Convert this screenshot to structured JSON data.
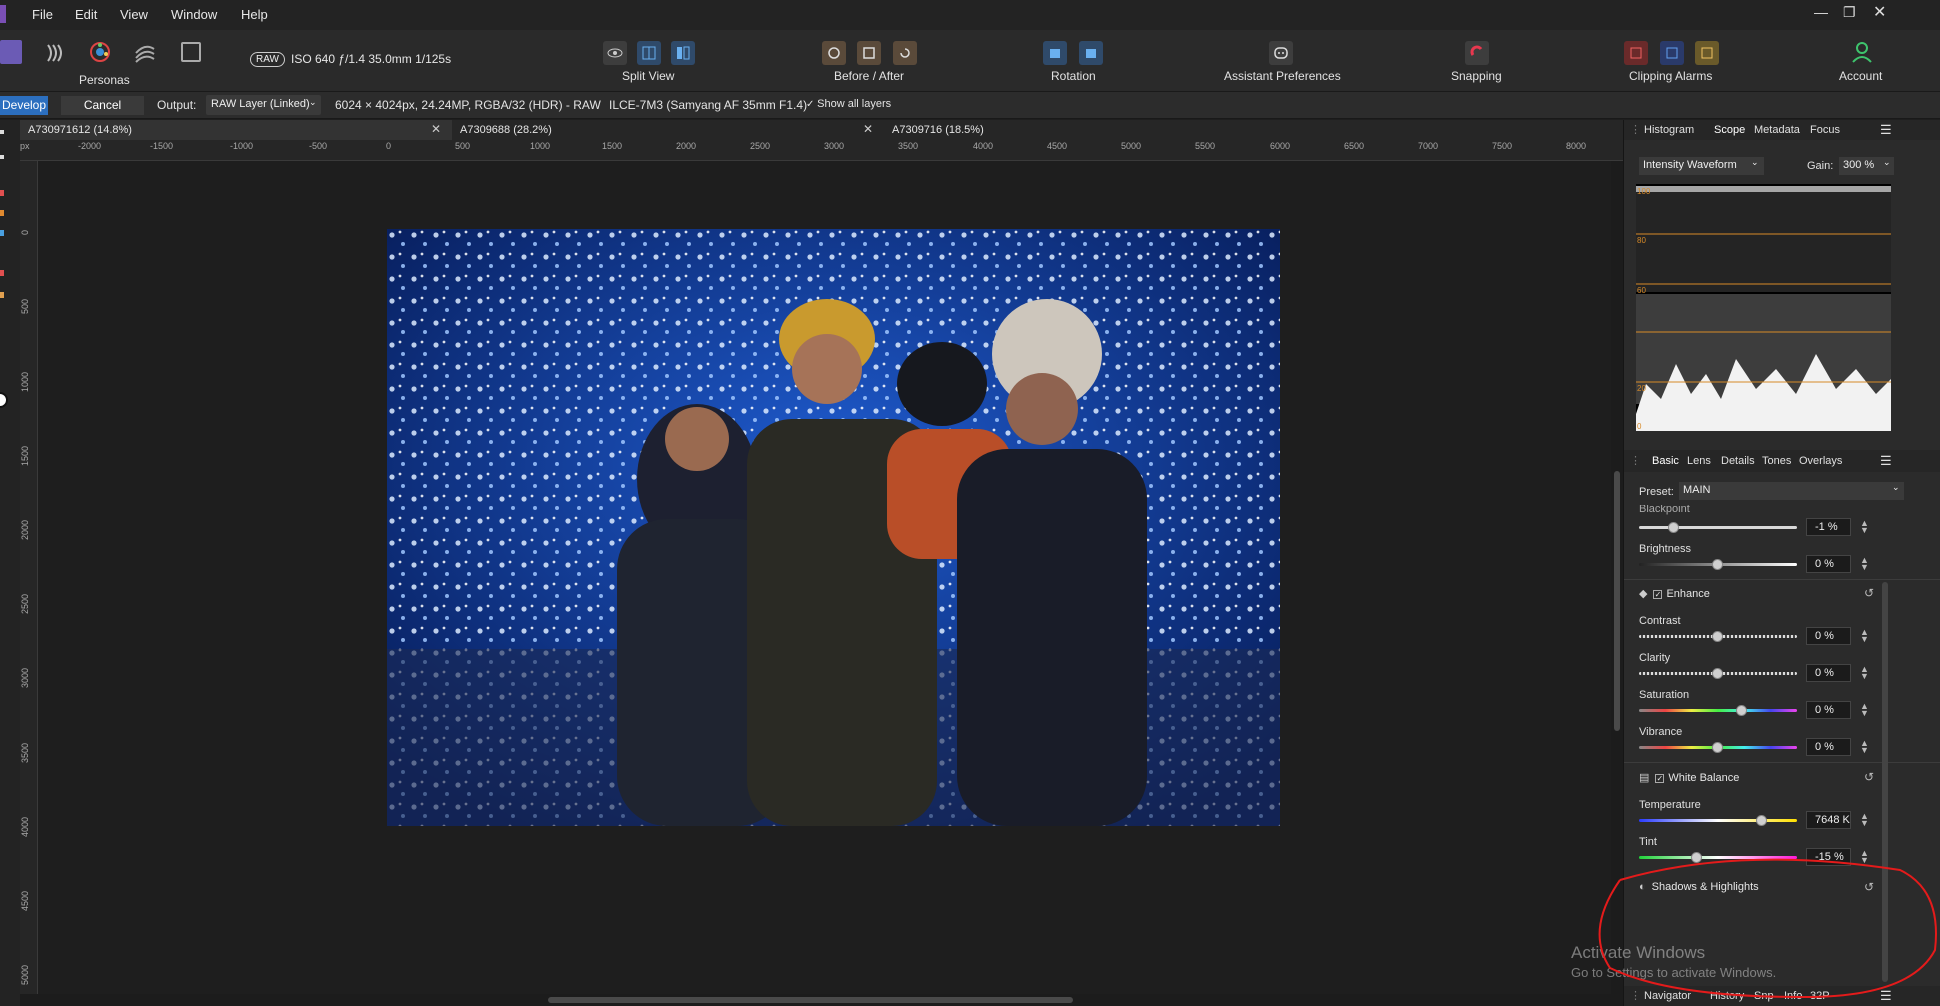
{
  "menu": [
    "File",
    "Edit",
    "View",
    "Window",
    "Help"
  ],
  "toolbar": {
    "personas_label": "Personas",
    "raw_badge": "RAW",
    "exif": "ISO 640 ƒ/1.4 35.0mm 1/125s",
    "split_view": "Split View",
    "before_after": "Before / After",
    "rotation": "Rotation",
    "assistant": "Assistant Preferences",
    "snapping": "Snapping",
    "clipping": "Clipping Alarms",
    "account": "Account"
  },
  "context": {
    "develop": "Develop",
    "cancel": "Cancel",
    "output_label": "Output:",
    "output_value": "RAW Layer (Linked)",
    "image_info": "6024 × 4024px, 24.24MP, RGBA/32 (HDR) - RAW",
    "camera": "ILCE-7M3 (Samyang AF 35mm F1.4)",
    "show_layers": "Show all layers"
  },
  "tabs": [
    "A730971612 (14.8%)",
    "A7309688 (28.2%)",
    "A7309716 (18.5%)"
  ],
  "ruler": {
    "unit": "px",
    "h": [
      "-2000",
      "-1500",
      "-1000",
      "-500",
      "0",
      "500",
      "1000",
      "1500",
      "2000",
      "2500",
      "3000",
      "3500",
      "4000",
      "4500",
      "5000",
      "5500",
      "6000",
      "6500",
      "7000",
      "7500",
      "8000"
    ],
    "v": [
      "0",
      "500",
      "1000",
      "1500",
      "2000",
      "2500",
      "3000",
      "3500",
      "4000",
      "4500",
      "5000"
    ]
  },
  "scope_panel": {
    "tabs": [
      "Histogram",
      "Scope",
      "Metadata",
      "Focus"
    ],
    "mode": "Intensity Waveform",
    "gain_label": "Gain:",
    "gain_value": "300 %",
    "levels": [
      "100",
      "80",
      "60",
      "20",
      "0"
    ]
  },
  "basic_panel": {
    "tabs": [
      "Basic",
      "Lens",
      "Details",
      "Tones",
      "Overlays"
    ],
    "preset_label": "Preset:",
    "preset_value": "MAIN",
    "blackpoint_label": "Blackpoint",
    "blackpoint_value": "-1 %",
    "brightness_label": "Brightness",
    "brightness_value": "0 %",
    "enhance_label": "Enhance",
    "contrast_label": "Contrast",
    "contrast_value": "0 %",
    "clarity_label": "Clarity",
    "clarity_value": "0 %",
    "saturation_label": "Saturation",
    "saturation_value": "0 %",
    "vibrance_label": "Vibrance",
    "vibrance_value": "0 %",
    "wb_label": "White Balance",
    "temperature_label": "Temperature",
    "temperature_value": "7648 K",
    "tint_label": "Tint",
    "tint_value": "-15 %",
    "shadows_label": "Shadows & Highlights"
  },
  "slider_levels": {
    "blackpoint": 0.22,
    "brightness": 0.5,
    "contrast": 0.5,
    "clarity": 0.5,
    "saturation": 0.65,
    "vibrance": 0.5,
    "temperature": 0.78,
    "tint": 0.37
  },
  "bottom_tabs": [
    "Navigator",
    "History",
    "Snp",
    "Info",
    "32P"
  ],
  "watermark": {
    "line1": "Activate Windows",
    "line2": "Go to Settings to activate Windows."
  }
}
